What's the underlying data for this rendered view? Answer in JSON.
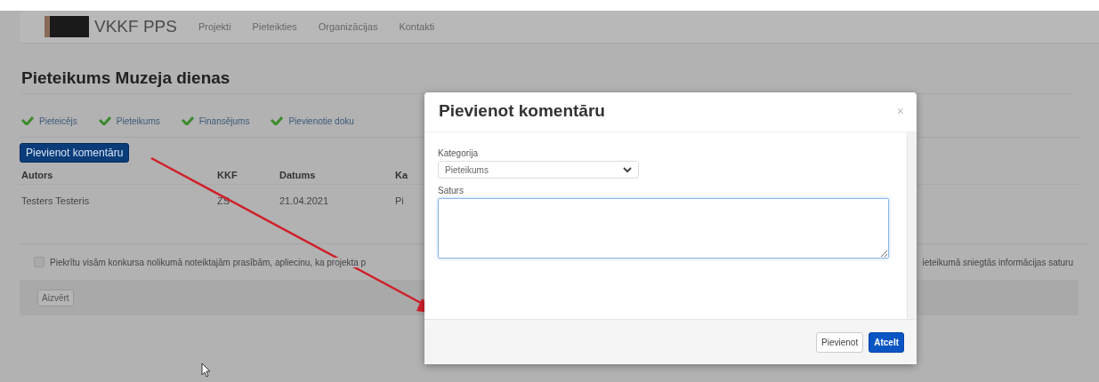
{
  "navbar": {
    "brand": "VKKF PPS",
    "links": [
      "Projekti",
      "Pieteikties",
      "Organizācijas",
      "Kontakti"
    ]
  },
  "page_title": "Pieteikums Muzeja dienas",
  "steps": [
    {
      "label": "Pieteicējs",
      "done": true
    },
    {
      "label": "Pieteikums",
      "done": true
    },
    {
      "label": "Finansējums",
      "done": true
    },
    {
      "label": "Pievienotie doku",
      "done": true
    }
  ],
  "add_comment_button": "Pievienot komentāru",
  "table": {
    "columns": [
      "Autors",
      "KKF",
      "Datums",
      "Ka"
    ],
    "rows": [
      [
        "Testers Testeris",
        "ZS",
        "21.04.2021",
        "Pi"
      ]
    ]
  },
  "agreement": {
    "checked": false,
    "text_left": "Piekrītu visām konkursa nolikumā noteiktajām prasībām, apliecinu, ka projekta p",
    "text_right": "ieteikumā sniegtās informācijas saturu"
  },
  "close_button": "Aizvērt",
  "modal": {
    "title": "Pievienot komentāru",
    "close": "×",
    "category_label": "Kategorija",
    "category_value": "Pieteikums",
    "content_label": "Saturs",
    "buttons": [
      {
        "label": "Pievienot",
        "primary": false
      },
      {
        "label": "Atcelt",
        "primary": true
      }
    ]
  }
}
